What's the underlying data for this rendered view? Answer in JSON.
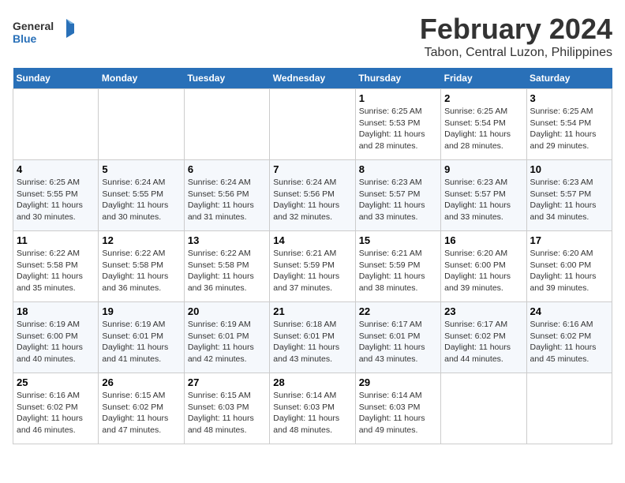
{
  "logo": {
    "line1": "General",
    "line2": "Blue"
  },
  "title": "February 2024",
  "subtitle": "Tabon, Central Luzon, Philippines",
  "weekdays": [
    "Sunday",
    "Monday",
    "Tuesday",
    "Wednesday",
    "Thursday",
    "Friday",
    "Saturday"
  ],
  "weeks": [
    [
      {
        "day": "",
        "sunrise": "",
        "sunset": "",
        "daylight": ""
      },
      {
        "day": "",
        "sunrise": "",
        "sunset": "",
        "daylight": ""
      },
      {
        "day": "",
        "sunrise": "",
        "sunset": "",
        "daylight": ""
      },
      {
        "day": "",
        "sunrise": "",
        "sunset": "",
        "daylight": ""
      },
      {
        "day": "1",
        "sunrise": "Sunrise: 6:25 AM",
        "sunset": "Sunset: 5:53 PM",
        "daylight": "Daylight: 11 hours and 28 minutes."
      },
      {
        "day": "2",
        "sunrise": "Sunrise: 6:25 AM",
        "sunset": "Sunset: 5:54 PM",
        "daylight": "Daylight: 11 hours and 28 minutes."
      },
      {
        "day": "3",
        "sunrise": "Sunrise: 6:25 AM",
        "sunset": "Sunset: 5:54 PM",
        "daylight": "Daylight: 11 hours and 29 minutes."
      }
    ],
    [
      {
        "day": "4",
        "sunrise": "Sunrise: 6:25 AM",
        "sunset": "Sunset: 5:55 PM",
        "daylight": "Daylight: 11 hours and 30 minutes."
      },
      {
        "day": "5",
        "sunrise": "Sunrise: 6:24 AM",
        "sunset": "Sunset: 5:55 PM",
        "daylight": "Daylight: 11 hours and 30 minutes."
      },
      {
        "day": "6",
        "sunrise": "Sunrise: 6:24 AM",
        "sunset": "Sunset: 5:56 PM",
        "daylight": "Daylight: 11 hours and 31 minutes."
      },
      {
        "day": "7",
        "sunrise": "Sunrise: 6:24 AM",
        "sunset": "Sunset: 5:56 PM",
        "daylight": "Daylight: 11 hours and 32 minutes."
      },
      {
        "day": "8",
        "sunrise": "Sunrise: 6:23 AM",
        "sunset": "Sunset: 5:57 PM",
        "daylight": "Daylight: 11 hours and 33 minutes."
      },
      {
        "day": "9",
        "sunrise": "Sunrise: 6:23 AM",
        "sunset": "Sunset: 5:57 PM",
        "daylight": "Daylight: 11 hours and 33 minutes."
      },
      {
        "day": "10",
        "sunrise": "Sunrise: 6:23 AM",
        "sunset": "Sunset: 5:57 PM",
        "daylight": "Daylight: 11 hours and 34 minutes."
      }
    ],
    [
      {
        "day": "11",
        "sunrise": "Sunrise: 6:22 AM",
        "sunset": "Sunset: 5:58 PM",
        "daylight": "Daylight: 11 hours and 35 minutes."
      },
      {
        "day": "12",
        "sunrise": "Sunrise: 6:22 AM",
        "sunset": "Sunset: 5:58 PM",
        "daylight": "Daylight: 11 hours and 36 minutes."
      },
      {
        "day": "13",
        "sunrise": "Sunrise: 6:22 AM",
        "sunset": "Sunset: 5:58 PM",
        "daylight": "Daylight: 11 hours and 36 minutes."
      },
      {
        "day": "14",
        "sunrise": "Sunrise: 6:21 AM",
        "sunset": "Sunset: 5:59 PM",
        "daylight": "Daylight: 11 hours and 37 minutes."
      },
      {
        "day": "15",
        "sunrise": "Sunrise: 6:21 AM",
        "sunset": "Sunset: 5:59 PM",
        "daylight": "Daylight: 11 hours and 38 minutes."
      },
      {
        "day": "16",
        "sunrise": "Sunrise: 6:20 AM",
        "sunset": "Sunset: 6:00 PM",
        "daylight": "Daylight: 11 hours and 39 minutes."
      },
      {
        "day": "17",
        "sunrise": "Sunrise: 6:20 AM",
        "sunset": "Sunset: 6:00 PM",
        "daylight": "Daylight: 11 hours and 39 minutes."
      }
    ],
    [
      {
        "day": "18",
        "sunrise": "Sunrise: 6:19 AM",
        "sunset": "Sunset: 6:00 PM",
        "daylight": "Daylight: 11 hours and 40 minutes."
      },
      {
        "day": "19",
        "sunrise": "Sunrise: 6:19 AM",
        "sunset": "Sunset: 6:01 PM",
        "daylight": "Daylight: 11 hours and 41 minutes."
      },
      {
        "day": "20",
        "sunrise": "Sunrise: 6:19 AM",
        "sunset": "Sunset: 6:01 PM",
        "daylight": "Daylight: 11 hours and 42 minutes."
      },
      {
        "day": "21",
        "sunrise": "Sunrise: 6:18 AM",
        "sunset": "Sunset: 6:01 PM",
        "daylight": "Daylight: 11 hours and 43 minutes."
      },
      {
        "day": "22",
        "sunrise": "Sunrise: 6:17 AM",
        "sunset": "Sunset: 6:01 PM",
        "daylight": "Daylight: 11 hours and 43 minutes."
      },
      {
        "day": "23",
        "sunrise": "Sunrise: 6:17 AM",
        "sunset": "Sunset: 6:02 PM",
        "daylight": "Daylight: 11 hours and 44 minutes."
      },
      {
        "day": "24",
        "sunrise": "Sunrise: 6:16 AM",
        "sunset": "Sunset: 6:02 PM",
        "daylight": "Daylight: 11 hours and 45 minutes."
      }
    ],
    [
      {
        "day": "25",
        "sunrise": "Sunrise: 6:16 AM",
        "sunset": "Sunset: 6:02 PM",
        "daylight": "Daylight: 11 hours and 46 minutes."
      },
      {
        "day": "26",
        "sunrise": "Sunrise: 6:15 AM",
        "sunset": "Sunset: 6:02 PM",
        "daylight": "Daylight: 11 hours and 47 minutes."
      },
      {
        "day": "27",
        "sunrise": "Sunrise: 6:15 AM",
        "sunset": "Sunset: 6:03 PM",
        "daylight": "Daylight: 11 hours and 48 minutes."
      },
      {
        "day": "28",
        "sunrise": "Sunrise: 6:14 AM",
        "sunset": "Sunset: 6:03 PM",
        "daylight": "Daylight: 11 hours and 48 minutes."
      },
      {
        "day": "29",
        "sunrise": "Sunrise: 6:14 AM",
        "sunset": "Sunset: 6:03 PM",
        "daylight": "Daylight: 11 hours and 49 minutes."
      },
      {
        "day": "",
        "sunrise": "",
        "sunset": "",
        "daylight": ""
      },
      {
        "day": "",
        "sunrise": "",
        "sunset": "",
        "daylight": ""
      }
    ]
  ]
}
